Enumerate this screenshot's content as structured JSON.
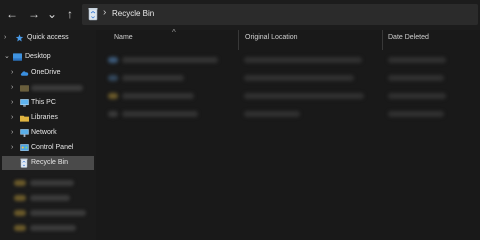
{
  "toolbar": {
    "back_glyph": "←",
    "forward_glyph": "→",
    "recent_glyph": "⌄",
    "up_glyph": "↑"
  },
  "address": {
    "separator": "›",
    "location": "Recycle Bin",
    "icon": "recycle-bin-icon"
  },
  "sidebar": {
    "items": [
      {
        "label": "Quick access",
        "chevron": "›",
        "icon": "star-icon"
      },
      {
        "label": "Desktop",
        "chevron": "⌄",
        "icon": "desktop-icon"
      },
      {
        "label": "OneDrive",
        "chevron": "›",
        "icon": "cloud-icon"
      },
      {
        "label": "",
        "chevron": "›",
        "icon": "user-folder-icon"
      },
      {
        "label": "This PC",
        "chevron": "›",
        "icon": "pc-icon"
      },
      {
        "label": "Libraries",
        "chevron": "›",
        "icon": "libraries-icon"
      },
      {
        "label": "Network",
        "chevron": "›",
        "icon": "network-icon"
      },
      {
        "label": "Control Panel",
        "chevron": "›",
        "icon": "control-panel-icon"
      },
      {
        "label": "Recycle Bin",
        "chevron": "",
        "icon": "recycle-bin-icon",
        "selected": true
      }
    ]
  },
  "columns": {
    "name": "Name",
    "original_location": "Original Location",
    "date_deleted": "Date Deleted",
    "sort_glyph": "^"
  },
  "colors": {
    "background": "#191919",
    "selected": "#4a4a4a",
    "folder": "#d9b24a",
    "onedrive": "#3a8fe0"
  }
}
